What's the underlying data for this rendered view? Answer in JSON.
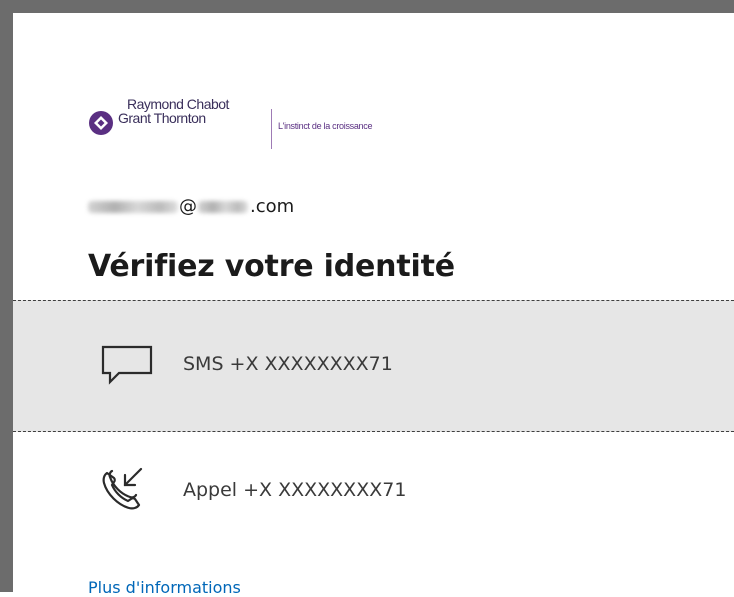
{
  "brand": {
    "name_line1": "Raymond Chabot",
    "name_line2": "Grant Thornton",
    "tagline": "L'instinct de la croissance",
    "colors": {
      "primary": "#5a2f82",
      "accent": "#3a2f5b"
    }
  },
  "account": {
    "email_suffix_at": "@",
    "email_suffix_tld": ".com"
  },
  "page": {
    "title": "Vérifiez votre identité"
  },
  "options": [
    {
      "icon": "sms-chat-icon",
      "label": "SMS +X XXXXXXXX71"
    },
    {
      "icon": "phone-call-icon",
      "label": "Appel +X XXXXXXXX71"
    }
  ],
  "links": {
    "more_info": "Plus d'informations",
    "link_color": "#0067b8"
  }
}
